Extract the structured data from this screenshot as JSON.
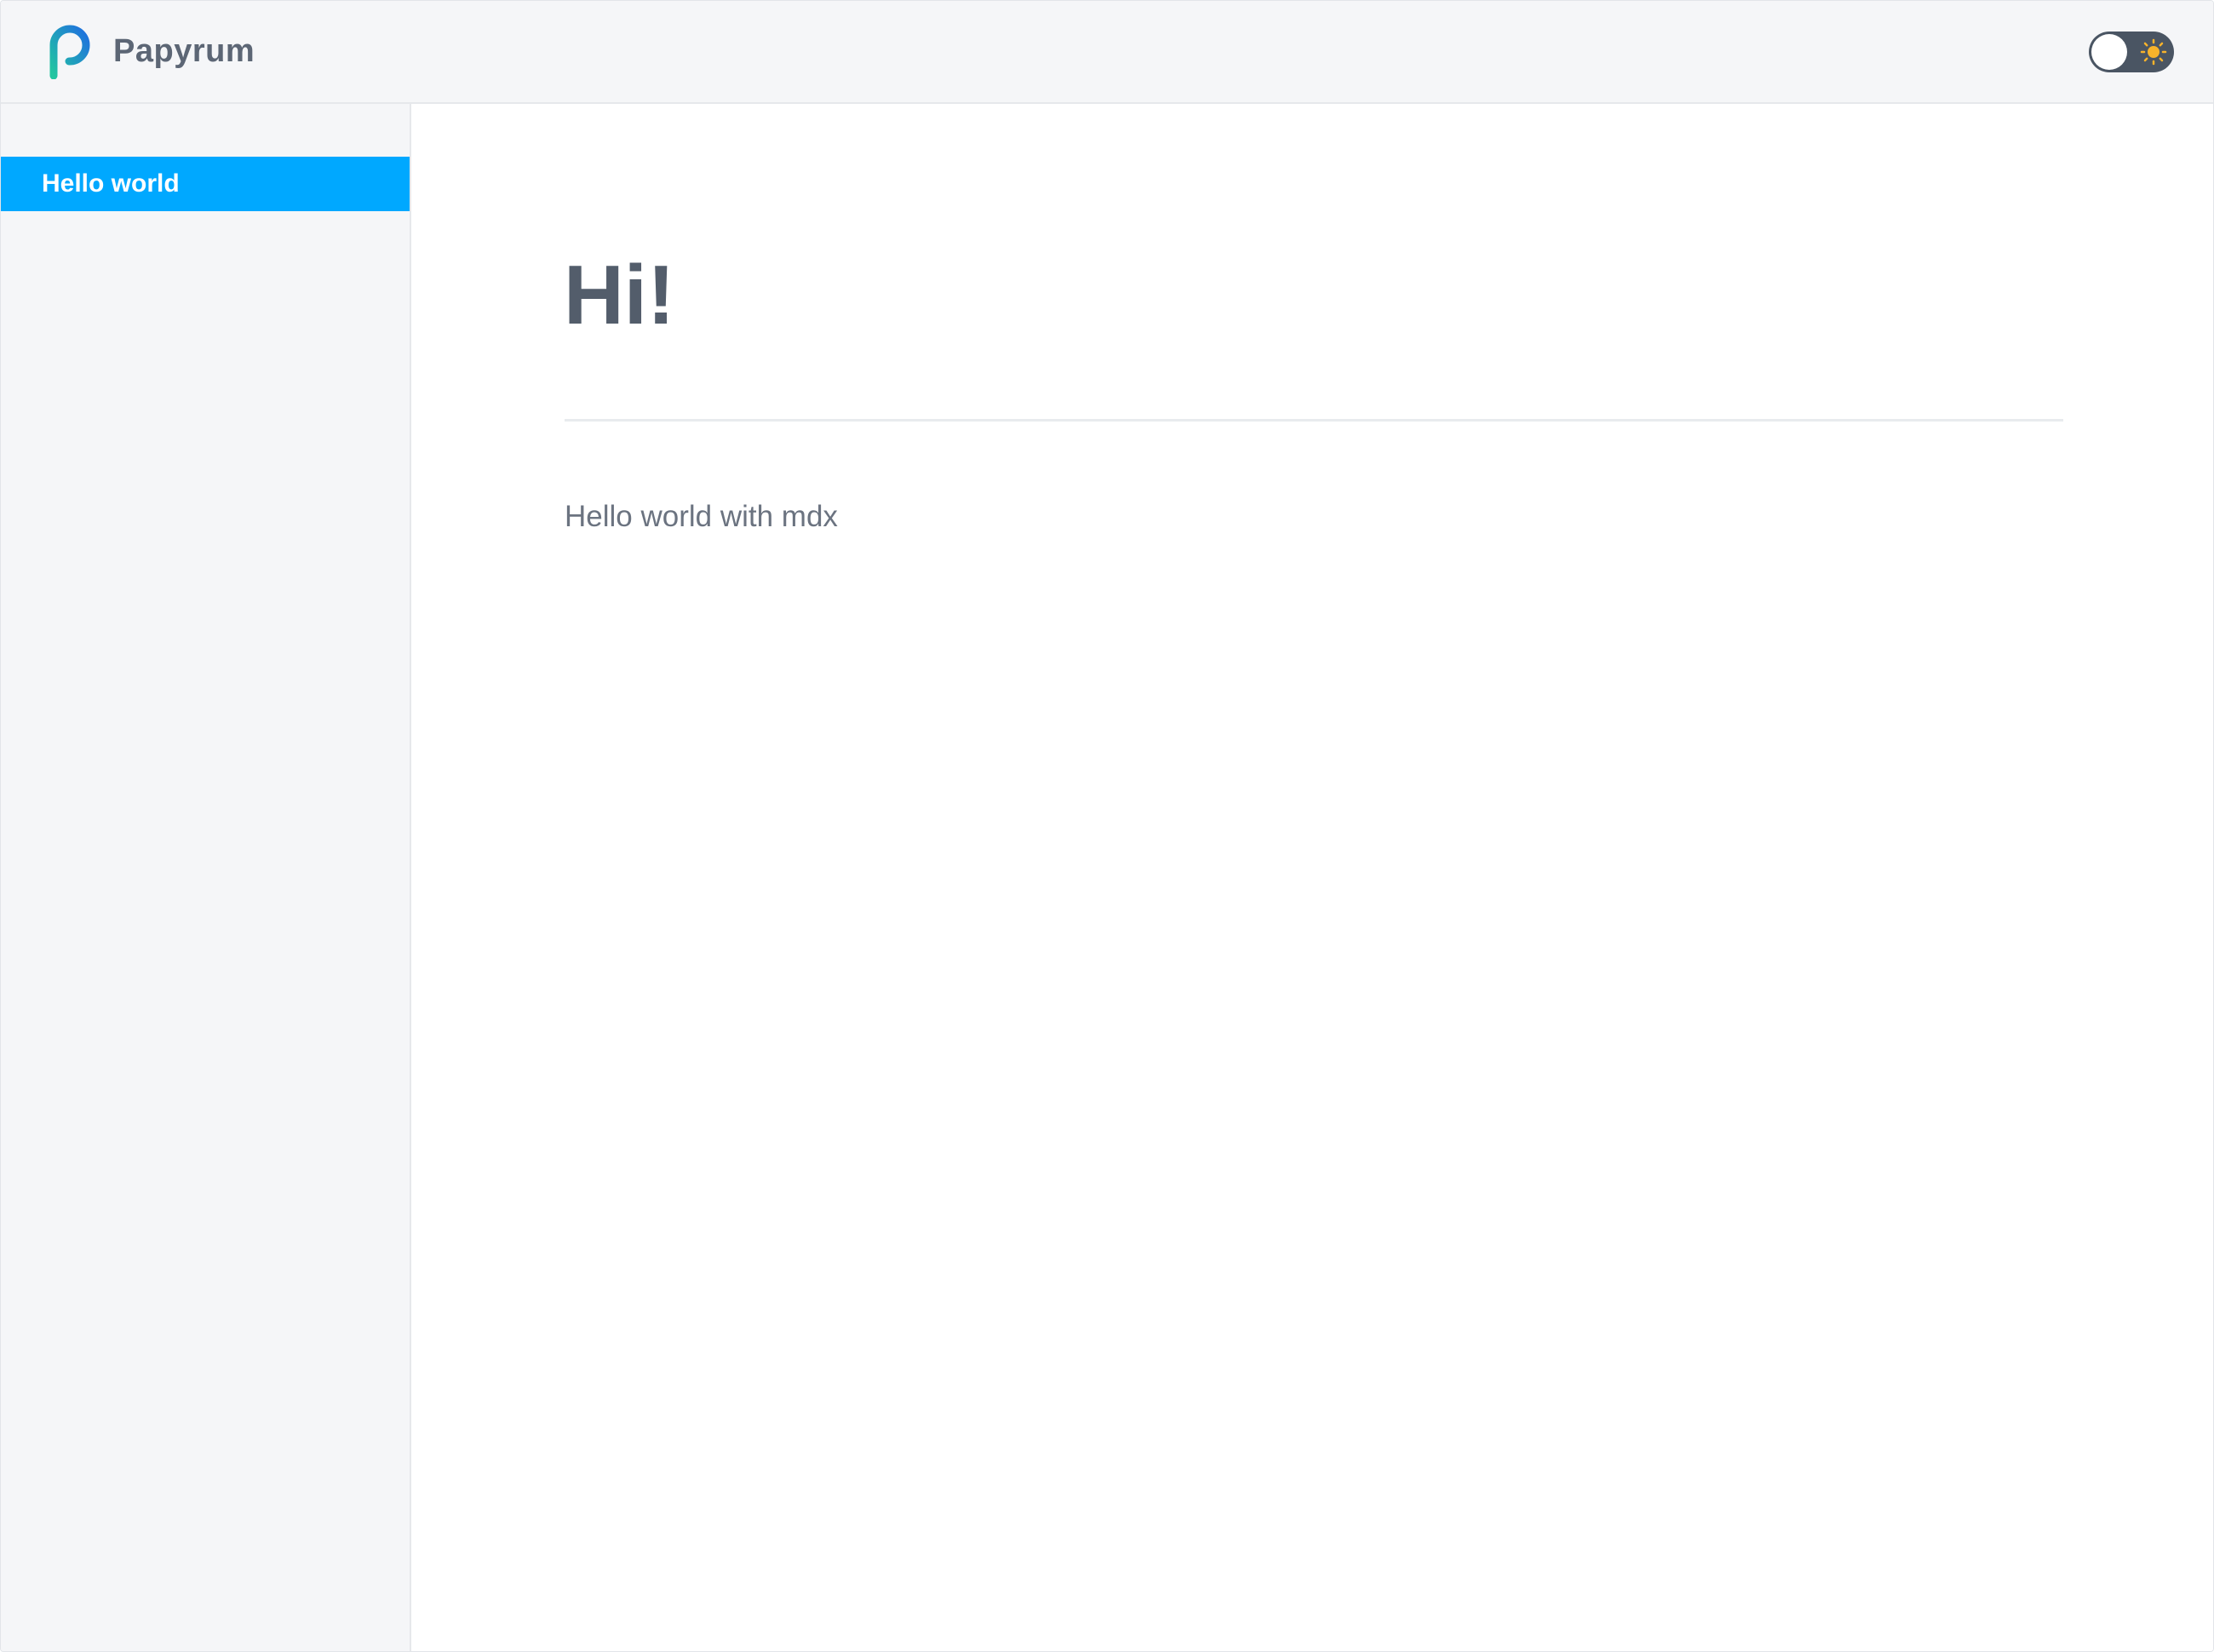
{
  "header": {
    "brand": "Papyrum",
    "logo_icon": "papyrum-p-logo-icon",
    "theme_toggle": {
      "state": "light",
      "icon": "sun-icon"
    }
  },
  "sidebar": {
    "items": [
      {
        "label": "Hello world",
        "active": true
      }
    ]
  },
  "main": {
    "title": "Hi!",
    "body": "Hello world with mdx"
  },
  "colors": {
    "accent": "#00a8ff",
    "header_bg": "#f5f6f8",
    "toggle_bg": "#4a5563",
    "sun": "#f7b32b",
    "text": "#535d6b"
  }
}
